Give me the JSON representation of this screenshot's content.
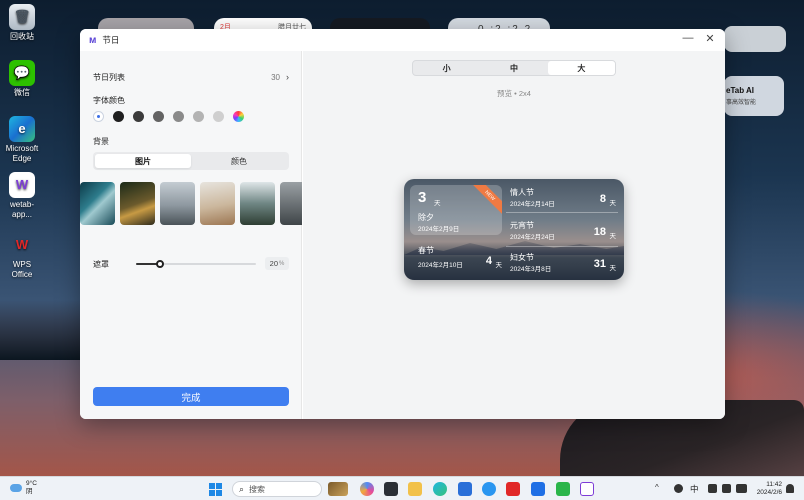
{
  "desktop": {
    "icons": [
      {
        "label": "回收站",
        "glyph": "🗑",
        "icon": "recycle-bin-icon"
      },
      {
        "label": "微信",
        "glyph": "💬",
        "icon": "wechat-icon"
      },
      {
        "label": "Microsoft Edge",
        "glyph": "e",
        "icon": "edge-icon"
      },
      {
        "label": "wetab-app...",
        "glyph": "W",
        "icon": "wetab-icon"
      },
      {
        "label": "WPS Office",
        "glyph": "W",
        "icon": "wps-icon"
      }
    ],
    "widgets": {
      "calendar_month": "2月",
      "calendar_lunar": "腊月廿七",
      "clock_partial": "0  :2  :2  2",
      "wetab_title": "eTab AI",
      "wetab_subtitle": "事高效智能"
    }
  },
  "window": {
    "title": "节日",
    "minimize": "—",
    "close": "✕"
  },
  "settings": {
    "holiday_list_label": "节日列表",
    "holiday_count": "30",
    "font_color_label": "字体颜色",
    "font_colors": [
      "#ffffff",
      "#1f1f1f",
      "#3b3b3b",
      "#636363",
      "#8a8a8a",
      "#b3b3b3",
      "#cfcfcf"
    ],
    "background_label": "背景",
    "bg_tabs": [
      "图片",
      "颜色"
    ],
    "bg_active_tab": "图片",
    "mask_label": "遮罩",
    "mask_value": "20",
    "mask_unit": "%",
    "mask_fraction": 0.2,
    "done_label": "完成"
  },
  "preview": {
    "size_tabs": [
      "小",
      "中",
      "大"
    ],
    "active_size": "大",
    "label": "预览 • 2x4",
    "main_holiday": {
      "days": "3",
      "unit": "天",
      "name": "除夕",
      "date": "2024年2月9日",
      "badge": "NEW"
    },
    "other_holidays": [
      {
        "name": "春节",
        "date": "2024年2月10日",
        "days": "4",
        "unit": "天"
      },
      {
        "name": "情人节",
        "date": "2024年2月14日",
        "days": "8",
        "unit": "天"
      },
      {
        "name": "元宵节",
        "date": "2024年2月24日",
        "days": "18",
        "unit": "天"
      },
      {
        "name": "妇女节",
        "date": "2024年3月8日",
        "days": "31",
        "unit": "天"
      }
    ]
  },
  "taskbar": {
    "weather_temp": "9°C",
    "weather_desc": "阴",
    "search_placeholder": "搜索",
    "ime": "中",
    "time": "11:42",
    "date": "2024/2/6"
  },
  "colors": {
    "accent": "#3f7ef0",
    "window_bg": "#ffffff",
    "panel_bg": "#f6f7f8",
    "badge": "#ef7a43"
  }
}
